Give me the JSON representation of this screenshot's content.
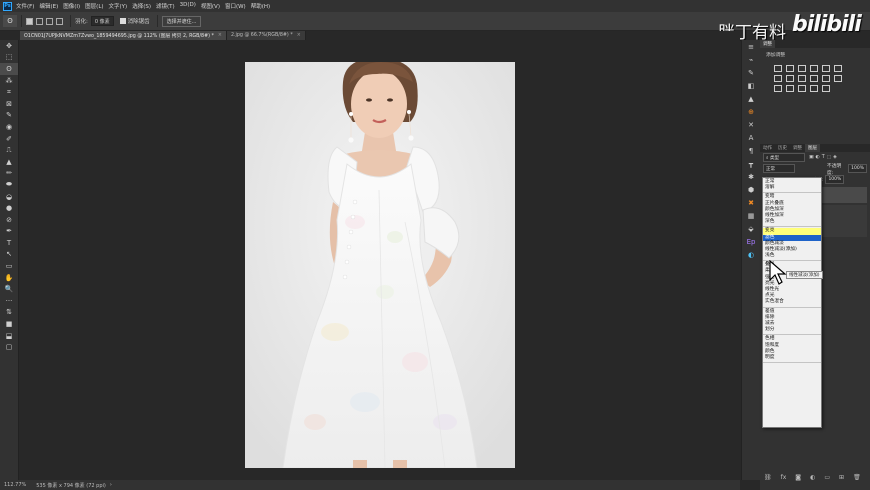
{
  "menu": [
    "文件(F)",
    "编辑(E)",
    "图像(I)",
    "图层(L)",
    "文字(Y)",
    "选择(S)",
    "滤镜(T)",
    "3D(D)",
    "视图(V)",
    "窗口(W)",
    "帮助(H)"
  ],
  "ps_logo": "Ps",
  "options": {
    "feather_label": "羽化:",
    "feather_value": "0 像素",
    "antialias_label": "消除锯齿",
    "select_mask_button": "选择并遮住..."
  },
  "tabs": [
    {
      "label": "O1CN01J7UPJkNVMZm7Zvwo_1859494695.jpg @ 112% (图层 拷贝 2, RGB/8#) *",
      "active": true
    },
    {
      "label": "2.jpg @ 66.7%(RGB/8#) *",
      "active": false
    }
  ],
  "tools": [
    "✥",
    "⬚",
    "ʘ",
    "⁂",
    "⌗",
    "⊠",
    "✎",
    "◉",
    "✐",
    "⎍",
    "▲",
    "✏",
    "⬬",
    "◒",
    "●",
    "⊘",
    "✒",
    "T",
    "↖",
    "▭",
    "✋",
    "🔍",
    "···",
    "⇅",
    "■",
    "⬓",
    "▢"
  ],
  "status": {
    "zoom": "112.77%",
    "doc_info": "535 像素 x 794 像素 (72 ppi)"
  },
  "watermark": {
    "text": "胖丁有料",
    "logo": "bilibili"
  },
  "right_icons": [
    "≡",
    "⌁",
    "✎",
    "◧",
    "▲",
    "⊕",
    "✕",
    "A",
    "¶",
    "┳",
    "✱",
    "⬢",
    "✖",
    "▦",
    "⬙",
    "Ep",
    "◐"
  ],
  "panels": {
    "adjust_tabs": [
      "调整"
    ],
    "adjust_title": "添加调整",
    "layers_tabs": [
      "动作",
      "历史",
      "调整",
      "图层"
    ],
    "kind_label": "类型",
    "blend_mode": "正常",
    "opacity_label": "不透明度:",
    "opacity_value": "100%",
    "fill_label": "填充:",
    "fill_value": "100%",
    "lock_label": "锁定:"
  },
  "blend_dropdown": [
    [
      "正常",
      "溶解"
    ],
    [
      "变暗",
      "正片叠底",
      "颜色加深",
      "线性加深",
      "深色"
    ],
    [
      "变亮",
      "滤色",
      "颜色减淡",
      "线性减淡(添加)",
      "浅色"
    ],
    [
      "叠加",
      "柔光",
      "强光",
      "亮光",
      "线性光",
      "点光",
      "实色混合"
    ],
    [
      "差值",
      "排除",
      "减去",
      "划分"
    ],
    [
      "色相",
      "饱和度",
      "颜色",
      "明度"
    ]
  ],
  "dropdown_hover": "变亮",
  "dropdown_selected": "滤色",
  "tooltip": "线性减淡(添加)",
  "colors": {
    "selected": "#1e63c8",
    "hover": "#ffff7a"
  }
}
